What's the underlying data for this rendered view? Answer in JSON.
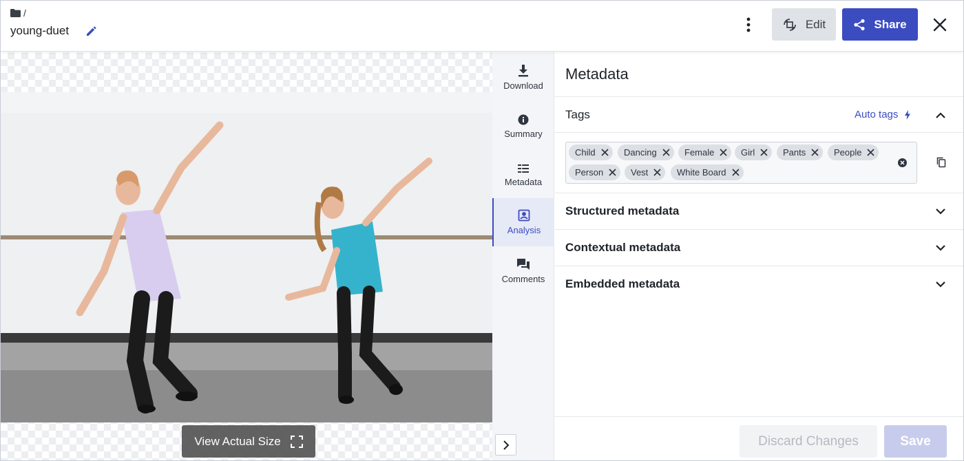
{
  "breadcrumb": {
    "separator": "/"
  },
  "asset": {
    "name": "young-duet"
  },
  "header": {
    "edit_label": "Edit",
    "share_label": "Share"
  },
  "viewer": {
    "view_actual_size_label": "View Actual Size"
  },
  "rail": {
    "items": [
      {
        "label": "Download",
        "icon": "download-icon"
      },
      {
        "label": "Summary",
        "icon": "info-icon"
      },
      {
        "label": "Metadata",
        "icon": "list-icon"
      },
      {
        "label": "Analysis",
        "icon": "analysis-icon",
        "active": true
      },
      {
        "label": "Comments",
        "icon": "comments-icon"
      }
    ]
  },
  "panel": {
    "title": "Metadata",
    "tags_label": "Tags",
    "auto_tags_label": "Auto tags",
    "tags": [
      "Child",
      "Dancing",
      "Female",
      "Girl",
      "Pants",
      "People",
      "Person",
      "Vest",
      "White Board"
    ],
    "sections": [
      "Structured metadata",
      "Contextual metadata",
      "Embedded metadata"
    ]
  },
  "footer": {
    "discard_label": "Discard Changes",
    "save_label": "Save"
  },
  "colors": {
    "accent": "#3b4cc0",
    "edit_bg": "#dfe2e7",
    "tag_bg": "#dcdfe4"
  }
}
